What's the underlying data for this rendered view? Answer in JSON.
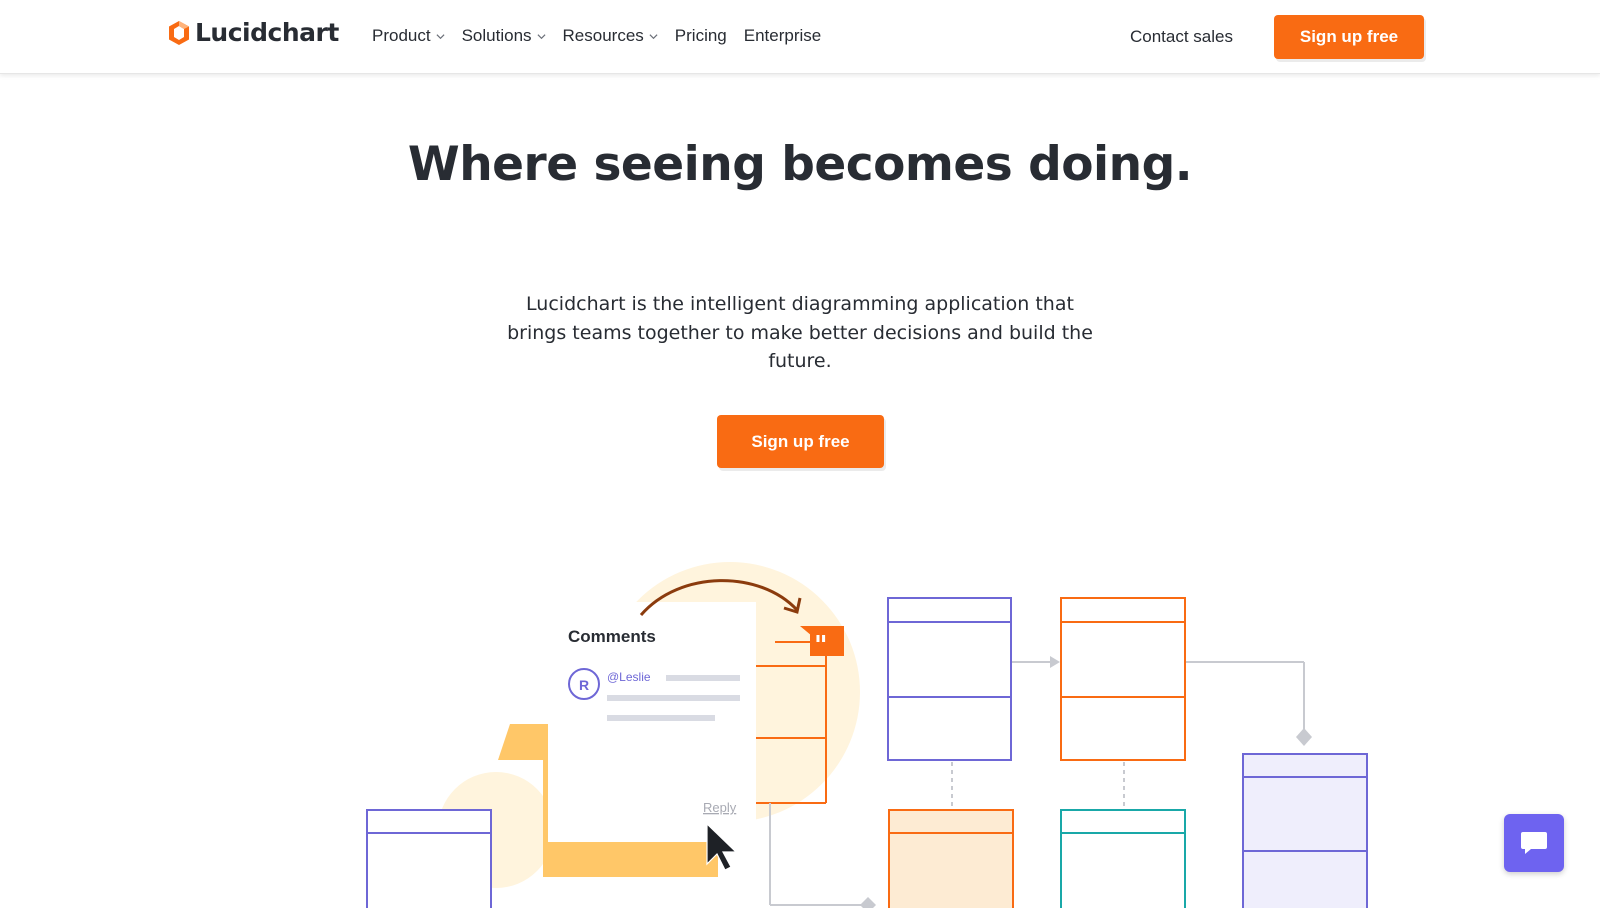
{
  "header": {
    "logo_text": "Lucidchart",
    "nav": [
      {
        "label": "Product",
        "has_dropdown": true
      },
      {
        "label": "Solutions",
        "has_dropdown": true
      },
      {
        "label": "Resources",
        "has_dropdown": true
      },
      {
        "label": "Pricing",
        "has_dropdown": false
      },
      {
        "label": "Enterprise",
        "has_dropdown": false
      }
    ],
    "contact_label": "Contact sales",
    "signup_label": "Sign up free"
  },
  "hero": {
    "title": "Where seeing becomes doing.",
    "subtitle": "Lucidchart is the intelligent diagramming application that brings teams together to make better decisions and build the future.",
    "cta_label": "Sign up free"
  },
  "illustration": {
    "comments_title": "Comments",
    "avatar_initial": "R",
    "mention": "@Leslie",
    "reply_label": "Reply"
  },
  "colors": {
    "brand_orange": "#f96b13",
    "purple": "#6e67d6",
    "teal": "#19a8a8",
    "soft_yellow": "#ffe7b5",
    "chat_purple": "#6e63f0"
  },
  "icons": {
    "logo": "lucid-logo-icon",
    "dropdown": "chevron-down-icon",
    "quote": "quote-icon",
    "cursor": "cursor-icon",
    "chat": "chat-bubble-icon"
  }
}
